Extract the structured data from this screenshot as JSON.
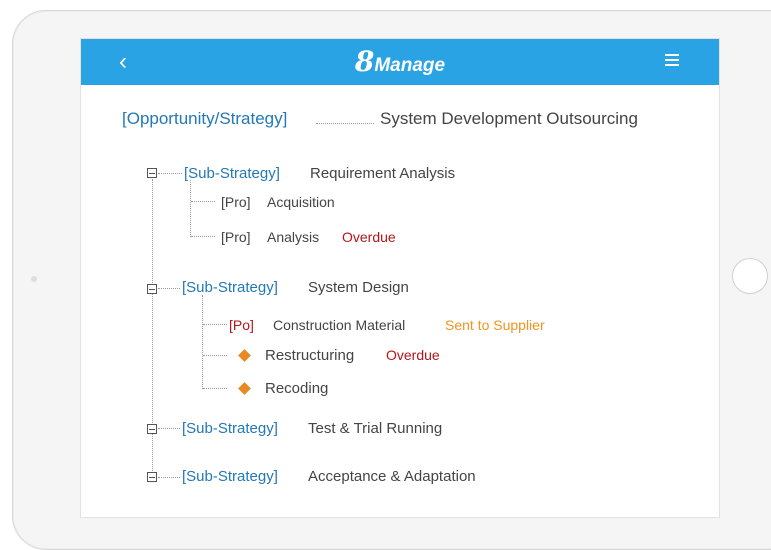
{
  "header": {
    "logo_number": "8",
    "logo_word": "Manage",
    "back_icon": "chevron-left-icon",
    "menu_icon": "hamburger-menu-icon",
    "bar_color": "#29a3e3"
  },
  "opportunity": {
    "tag": "[Opportunity/Strategy]",
    "name": "System Development Outsourcing"
  },
  "substrategies": [
    {
      "tag": "[Sub-Strategy]",
      "name": "Requirement Analysis",
      "children": [
        {
          "tag": "[Pro]",
          "name": "Acquisition",
          "status": ""
        },
        {
          "tag": "[Pro]",
          "name": "Analysis",
          "status": "Overdue"
        }
      ]
    },
    {
      "tag": "[Sub-Strategy]",
      "name": "System Design",
      "children": [
        {
          "tag": "[Po]",
          "name": "Construction Material",
          "status": "Sent to Supplier"
        },
        {
          "tag": "",
          "name": "Restructuring",
          "status": "Overdue"
        },
        {
          "tag": "",
          "name": "Recoding",
          "status": ""
        }
      ]
    },
    {
      "tag": "[Sub-Strategy]",
      "name": "Test & Trial Running",
      "children": []
    },
    {
      "tag": "[Sub-Strategy]",
      "name": "Acceptance & Adaptation",
      "children": []
    }
  ],
  "colors": {
    "tag_blue": "#2378b5",
    "overdue_red": "#b3151b",
    "sent_orange": "#f0931f",
    "diamond_orange": "#e8891f"
  }
}
